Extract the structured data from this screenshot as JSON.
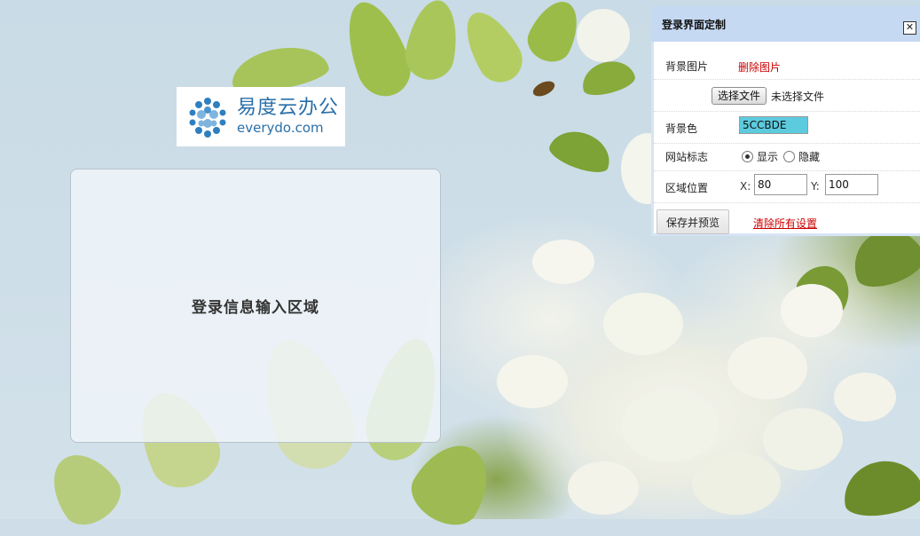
{
  "logo": {
    "name_cn": "易度云办公",
    "name_en": "everydo.com"
  },
  "login_area": {
    "label": "登录信息输入区域"
  },
  "settings_panel": {
    "title": "登录界面定制",
    "close_icon": "close-icon",
    "background_image": {
      "label": "背景图片",
      "delete_label": "删除图片",
      "file_button_label": "选择文件",
      "file_status": "未选择文件"
    },
    "background_color": {
      "label": "背景色",
      "value": "5CCBDE",
      "swatch": "#5CCBDE"
    },
    "site_logo": {
      "label": "网站标志",
      "options": [
        {
          "label": "显示",
          "checked": true
        },
        {
          "label": "隐藏",
          "checked": false
        }
      ]
    },
    "area_position": {
      "label": "区域位置",
      "x_label": "X:",
      "x_value": "80",
      "y_label": "Y:",
      "y_value": "100"
    },
    "save_button_label": "保存并预览",
    "clear_link_label": "清除所有设置"
  },
  "colors": {
    "panel_header": "#c6d9f3",
    "link_red": "#cc0000"
  }
}
